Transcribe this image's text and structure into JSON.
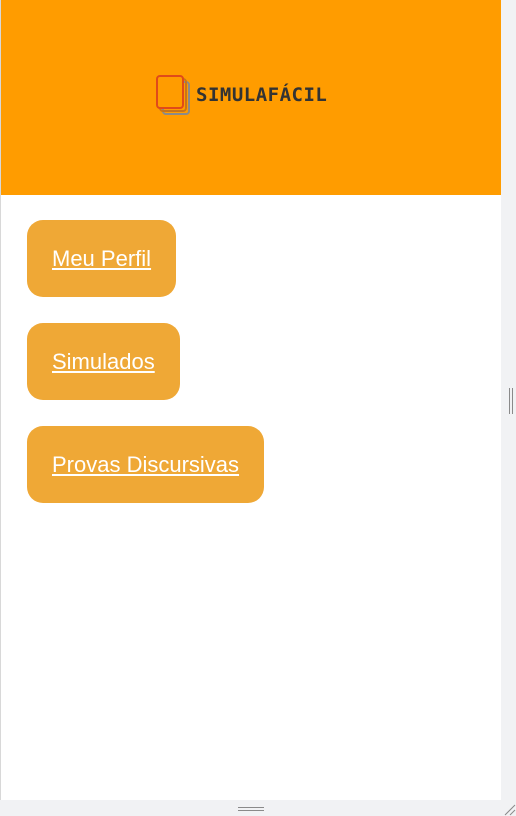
{
  "header": {
    "logo_text": "SIMULAFÁCIL",
    "logo_icon": "stacked-papers-icon",
    "background_color": "#ff9c00"
  },
  "nav": {
    "button_color": "#efa836",
    "items": [
      {
        "label": "Meu Perfil"
      },
      {
        "label": "Simulados"
      },
      {
        "label": "Provas Discursivas"
      }
    ]
  }
}
